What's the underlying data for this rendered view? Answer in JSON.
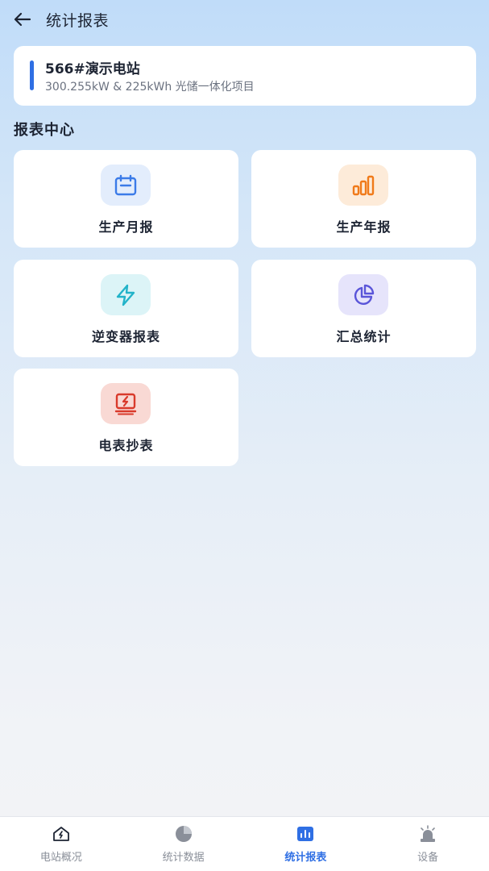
{
  "header": {
    "title": "统计报表",
    "back_icon": "arrow-left-icon"
  },
  "station": {
    "name": "566#演示电站",
    "description": "300.255kW & 225kWh 光储一体化项目",
    "accent_color": "#2f6fe4"
  },
  "report_center": {
    "title": "报表中心",
    "tiles": [
      {
        "label": "生产月报",
        "icon": "calendar-icon",
        "icon_color": "#3b7be8",
        "icon_bg": "#e3edfc"
      },
      {
        "label": "生产年报",
        "icon": "bar-chart-icon",
        "icon_color": "#f07a1a",
        "icon_bg": "#fdebd9"
      },
      {
        "label": "逆变器报表",
        "icon": "lightning-icon",
        "icon_color": "#22b3c9",
        "icon_bg": "#dcf4f7"
      },
      {
        "label": "汇总统计",
        "icon": "pie-chart-icon",
        "icon_color": "#5a55d9",
        "icon_bg": "#e6e4fb"
      },
      {
        "label": "电表抄表",
        "icon": "meter-icon",
        "icon_color": "#d93a2b",
        "icon_bg": "#f9d9d4"
      }
    ]
  },
  "bottom_nav": {
    "items": [
      {
        "label": "电站概况",
        "icon": "home-icon",
        "active": false
      },
      {
        "label": "统计数据",
        "icon": "pie-chart-icon",
        "active": false
      },
      {
        "label": "统计报表",
        "icon": "report-chart-icon",
        "active": true
      },
      {
        "label": "设备",
        "icon": "alarm-light-icon",
        "active": false
      }
    ],
    "active_color": "#2f6fe4"
  }
}
